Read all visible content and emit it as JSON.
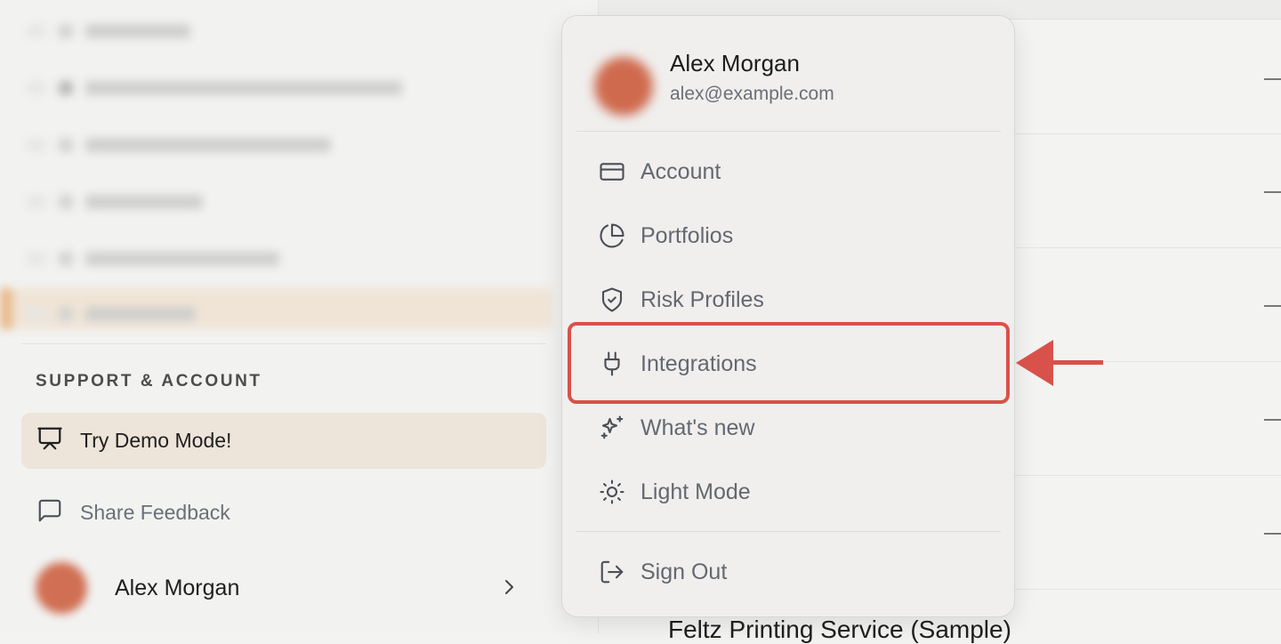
{
  "sidebar": {
    "section_heading": "SUPPORT & ACCOUNT",
    "demo_label": "Try Demo Mode!",
    "feedback_label": "Share Feedback",
    "user_name": "Alex Morgan"
  },
  "menu": {
    "user_name": "Alex Morgan",
    "user_email": "alex@example.com",
    "items": [
      {
        "label": "Account",
        "icon": "credit-card-icon"
      },
      {
        "label": "Portfolios",
        "icon": "pie-chart-icon"
      },
      {
        "label": "Risk Profiles",
        "icon": "shield-check-icon"
      },
      {
        "label": "Integrations",
        "icon": "plug-icon"
      },
      {
        "label": "What's new",
        "icon": "sparkles-icon"
      },
      {
        "label": "Light Mode",
        "icon": "sun-icon"
      }
    ],
    "sign_out_label": "Sign Out"
  },
  "main": {
    "partial_row_text": "Feltz Printing Service (Sample)"
  },
  "annotation": {
    "highlighted_item": "Integrations",
    "color": "#d9514b"
  }
}
